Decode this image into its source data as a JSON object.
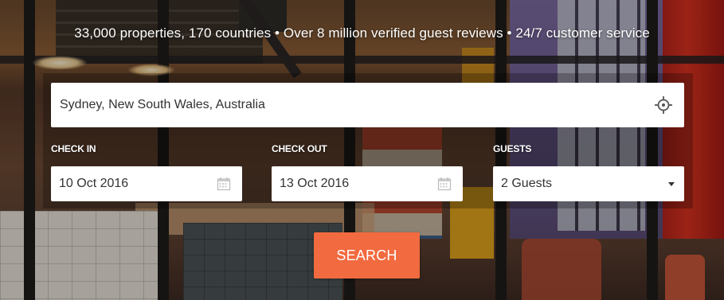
{
  "tagline": "33,000 properties, 170 countries • Over 8 million verified guest reviews • 24/7 customer service",
  "search": {
    "destination_value": "Sydney, New South Wales, Australia",
    "locate_icon": "crosshair-icon",
    "check_in": {
      "label": "CHECK IN",
      "value": "10 Oct 2016",
      "icon": "calendar-icon"
    },
    "check_out": {
      "label": "CHECK OUT",
      "value": "13 Oct 2016",
      "icon": "calendar-icon"
    },
    "guests": {
      "label": "GUESTS",
      "value": "2 Guests",
      "icon": "caret-down-icon"
    },
    "button_label": "SEARCH"
  },
  "colors": {
    "accent": "#f26a3f",
    "field_bg": "#ffffff",
    "text": "#333333"
  }
}
